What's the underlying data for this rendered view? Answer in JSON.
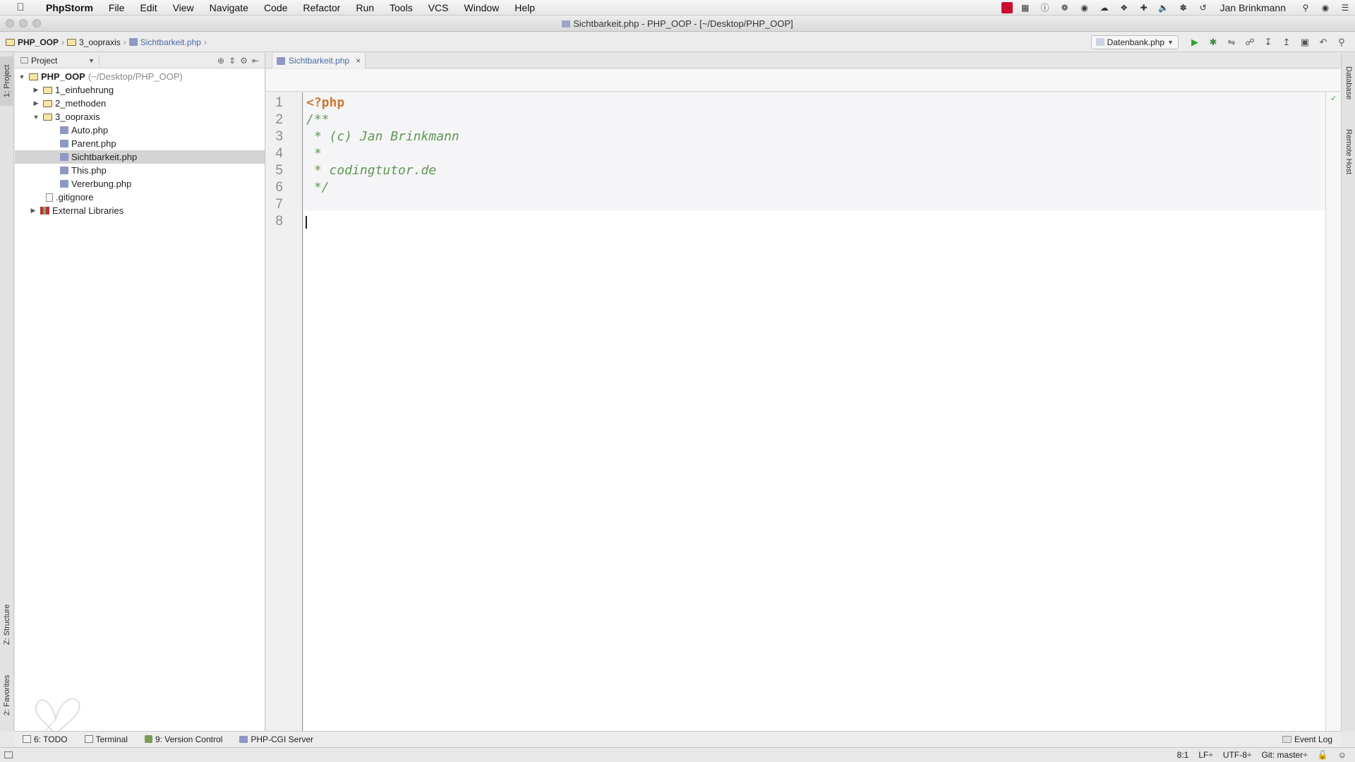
{
  "menubar": {
    "app": "PhpStorm",
    "items": [
      "File",
      "Edit",
      "View",
      "Navigate",
      "Code",
      "Refactor",
      "Run",
      "Tools",
      "VCS",
      "Window",
      "Help"
    ],
    "user": "Jan Brinkmann"
  },
  "window": {
    "title": "Sichtbarkeit.php - PHP_OOP - [~/Desktop/PHP_OOP]"
  },
  "navbar": {
    "breadcrumb": [
      "PHP_OOP",
      "3_oopraxis",
      "Sichtbarkeit.php"
    ],
    "run_config": "Datenbank.php"
  },
  "left_stripe": {
    "project_tab": "1: Project",
    "structure_tab": "Z: Structure",
    "favorites_tab": "2: Favorites"
  },
  "right_stripe": {
    "database_tab": "Database",
    "remote_tab": "Remote Host"
  },
  "project_panel": {
    "view_selector": "Project",
    "root_name": "PHP_OOP",
    "root_path": "(~/Desktop/PHP_OOP)",
    "folders": [
      "1_einfuehrung",
      "2_methoden",
      "3_oopraxis"
    ],
    "files": [
      "Auto.php",
      "Parent.php",
      "Sichtbarkeit.php",
      "This.php",
      "Vererbung.php"
    ],
    "gitignore": ".gitignore",
    "external": "External Libraries"
  },
  "editor": {
    "tab": "Sichtbarkeit.php",
    "line_numbers": [
      "1",
      "2",
      "3",
      "4",
      "5",
      "6",
      "7",
      "8"
    ],
    "lines": [
      "<?php",
      "/**",
      " * (c) Jan Brinkmann",
      " *",
      " * codingtutor.de",
      " */",
      "",
      ""
    ]
  },
  "bottom_tools": {
    "todo": "6: TODO",
    "terminal": "Terminal",
    "vcs": "9: Version Control",
    "cgi": "PHP-CGI Server",
    "event_log": "Event Log"
  },
  "status": {
    "position": "8:1",
    "line_sep": "LF÷",
    "encoding": "UTF-8÷",
    "git": "Git: master÷"
  }
}
